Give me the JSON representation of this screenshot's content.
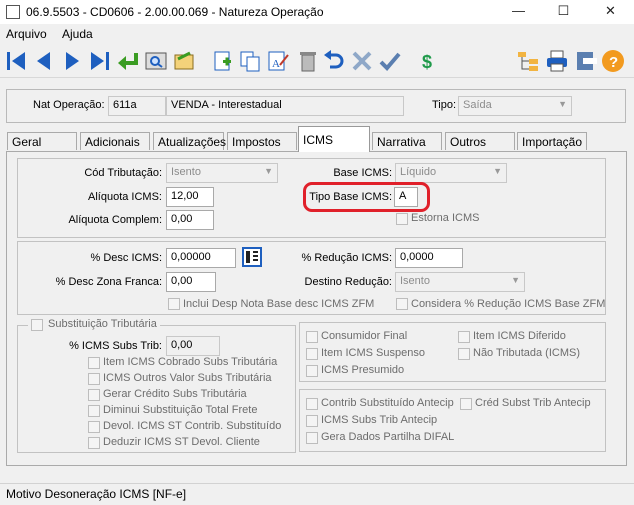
{
  "window": {
    "title": "06.9.5503 - CD0606 - 2.00.00.069 - Natureza Operação",
    "minimize": "—",
    "maximize": "☐",
    "close": "✕"
  },
  "menu": {
    "arquivo": "Arquivo",
    "ajuda": "Ajuda"
  },
  "header": {
    "nat_label": "Nat Operação:",
    "nat_code": "611a",
    "nat_desc": "VENDA - Interestadual",
    "tipo_label": "Tipo:",
    "tipo_value": "Saída"
  },
  "tabs": [
    "Geral",
    "Adicionais",
    "Atualizações",
    "Impostos",
    "ICMS",
    "Narrativa",
    "Outros",
    "Importação"
  ],
  "icms": {
    "cod_trib_label": "Cód Tributação:",
    "cod_trib_value": "Isento",
    "aliq_label": "Alíquota ICMS:",
    "aliq_value": "12,00",
    "aliq_comp_label": "Alíquota Complem:",
    "aliq_comp_value": "0,00",
    "base_label": "Base ICMS:",
    "base_value": "Líquido",
    "tipo_base_label": "Tipo Base ICMS:",
    "tipo_base_value": "A",
    "estorna_label": "Estorna ICMS"
  },
  "desc": {
    "desc_icms_label": "% Desc ICMS:",
    "desc_icms_value": "0,00000",
    "zona_label": "% Desc Zona Franca:",
    "zona_value": "0,00",
    "red_label": "% Redução ICMS:",
    "red_value": "0,0000",
    "destino_label": "Destino Redução:",
    "destino_value": "Isento",
    "inclui_label": "Inclui Desp Nota Base desc ICMS ZFM",
    "considera_label": "Considera % Redução ICMS Base ZFM"
  },
  "subst": {
    "title": "Substituição Tributária",
    "subs_label": "% ICMS Subs Trib:",
    "subs_value": "0,00",
    "items": [
      "Item ICMS Cobrado Subs Tributária",
      "ICMS Outros Valor Subs Tributária",
      "Gerar Crédito Subs Tributária",
      "Diminui Substituição Total Frete",
      "Devol. ICMS ST Contrib. Substituído",
      "Deduzir ICMS ST Devol. Cliente"
    ]
  },
  "right1": {
    "items": [
      "Consumidor Final",
      "Item ICMS Suspenso",
      "ICMS Presumido"
    ],
    "items2": [
      "Item ICMS Diferido",
      "Não Tributada (ICMS)"
    ]
  },
  "right2": {
    "items": [
      "Contrib Substituído Antecip",
      "ICMS Subs Trib Antecip",
      "Gera Dados Partilha DIFAL"
    ],
    "items2": [
      "Créd Subst Trib Antecip"
    ]
  },
  "status": "Motivo Desoneração ICMS [NF-e]",
  "colors": {
    "highlight": "#e0202a",
    "nav_blue": "#1e5fbf",
    "arrow_green": "#3a9c22"
  }
}
